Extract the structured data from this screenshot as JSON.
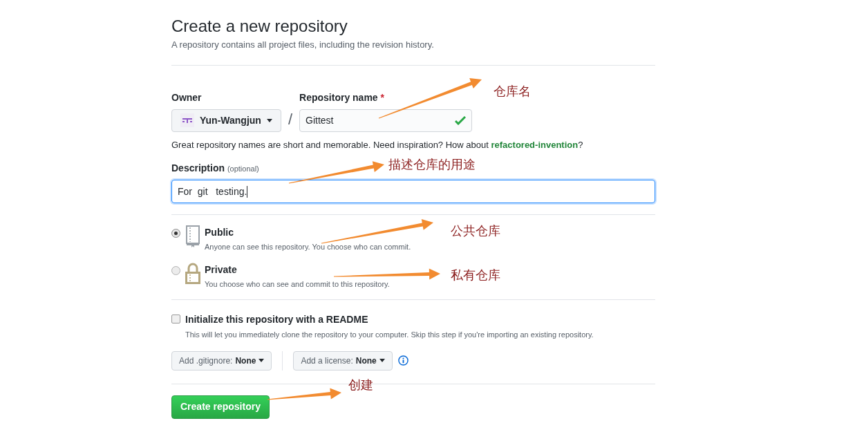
{
  "header": {
    "title": "Create a new repository",
    "subtitle": "A repository contains all project files, including the revision history."
  },
  "owner": {
    "label": "Owner",
    "value": "Yun-Wangjun"
  },
  "separator": "/",
  "repo_name": {
    "label": "Repository name",
    "required_mark": "*",
    "value": "Gittest",
    "valid": true
  },
  "name_hint": {
    "text": "Great repository names are short and memorable. Need inspiration? How about ",
    "suggestion": "refactored-invention",
    "end": "?"
  },
  "description": {
    "label": "Description",
    "optional": "(optional)",
    "value": "For  git   testing.",
    "focused": true
  },
  "visibility": [
    {
      "kind": "public",
      "title": "Public",
      "text": "Anyone can see this repository. You choose who can commit.",
      "selected": true
    },
    {
      "kind": "private",
      "title": "Private",
      "text": "You choose who can see and commit to this repository.",
      "selected": false
    }
  ],
  "readme": {
    "label": "Initialize this repository with a README",
    "text": "This will let you immediately clone the repository to your computer. Skip this step if you're importing an existing repository.",
    "checked": false
  },
  "dropdowns": [
    {
      "label": "Add .gitignore:",
      "value": "None"
    },
    {
      "label": "Add a license:",
      "value": "None"
    }
  ],
  "submit": "Create repository",
  "annotations": [
    "仓库名",
    "描述仓库的用途",
    "公共仓库",
    "私有仓库",
    "创建"
  ]
}
